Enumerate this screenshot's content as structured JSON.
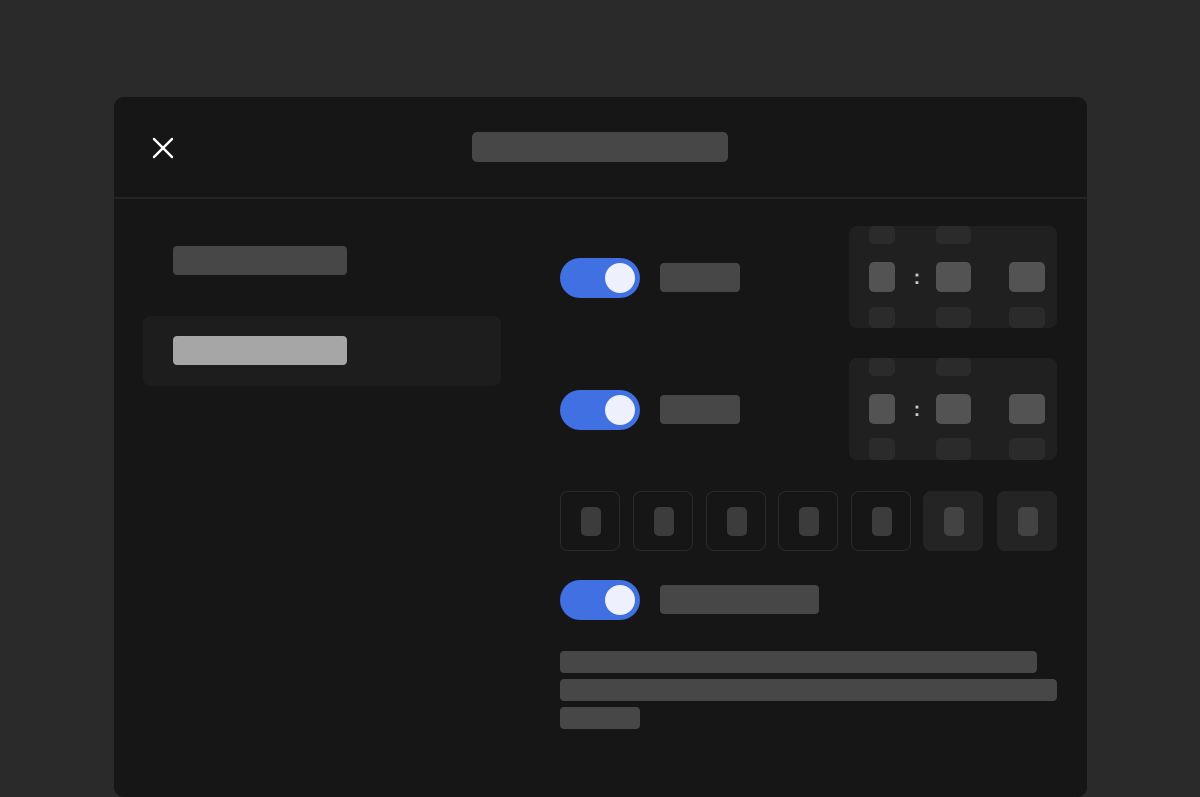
{
  "window": {
    "close_icon": "close-icon"
  },
  "sidebar": {
    "items": [
      {
        "id": "nav-1",
        "selected": false
      },
      {
        "id": "nav-2",
        "selected": true
      }
    ]
  },
  "settings": {
    "toggles": [
      {
        "id": "toggle-1",
        "on": true
      },
      {
        "id": "toggle-2",
        "on": true
      },
      {
        "id": "toggle-3",
        "on": true
      }
    ],
    "days": [
      {
        "id": "day-1",
        "selected": true
      },
      {
        "id": "day-2",
        "selected": true
      },
      {
        "id": "day-3",
        "selected": true
      },
      {
        "id": "day-4",
        "selected": true
      },
      {
        "id": "day-5",
        "selected": true
      },
      {
        "id": "day-6",
        "selected": false
      },
      {
        "id": "day-7",
        "selected": false
      }
    ],
    "time_separator": ":"
  },
  "colors": {
    "accent": "#4170e3",
    "knob": "#eef0fb",
    "background": "#2a2a2a",
    "dialog": "#161616"
  }
}
